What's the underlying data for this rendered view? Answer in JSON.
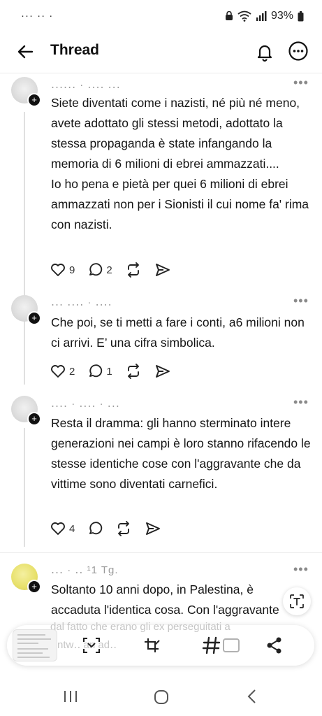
{
  "status_bar": {
    "left_text": "··· ·· ·",
    "battery": "93%"
  },
  "header": {
    "title": "Thread"
  },
  "posts": [
    {
      "author": "․․․․․․ · ․․․․ ․․․",
      "text": "Siete diventati come i nazisti, né più né meno, avete adottato gli stessi metodi, adottato la stessa propaganda è state infangando la memoria di 6 milioni di ebrei ammazzati....\nIo ho pena e pietà per quei 6 milioni di ebrei ammazzati non per i Sionisti il cui nome fa' rima con nazisti.",
      "likes": "9",
      "replies": "2"
    },
    {
      "author": "․․․ ․․․․ · ․․․․",
      "text": "Che poi, se ti metti a fare i conti, a6 milioni non ci arrivi. E’ una cifra simbolica.",
      "likes": "2",
      "replies": "1"
    },
    {
      "author": "․․․․ · ․․․․ · ․․․",
      "text": "Resta il dramma: gli hanno sterminato intere generazioni nei campi è loro stanno rifacendo le stesse identiche cose con l'aggravante che da vittime sono diventati carnefici.",
      "likes": "4",
      "replies": ""
    },
    {
      "author": "․․․ · ․․ ¹1 Tg.",
      "text": "Soltanto 10 anni dopo, in Palestina, è accaduta l'identica cosa. Con l'aggravante",
      "likes": "",
      "replies": ""
    }
  ],
  "composer": {
    "placeholder": "dal fatto che erano gli ex perseguitati a\nAntw․․ an ad․․"
  },
  "icons": {
    "back": "arrow-left-icon",
    "notifications": "bell-icon",
    "more": "more-horizontal-icon",
    "like": "heart-icon",
    "reply": "comment-icon",
    "repost": "repost-icon",
    "share": "share-icon",
    "translate": "translate-icon"
  }
}
